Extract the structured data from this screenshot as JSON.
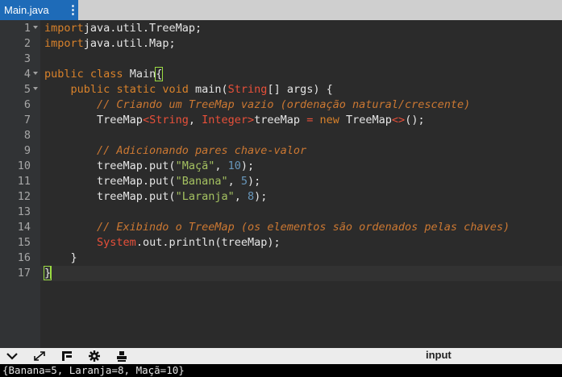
{
  "tab": {
    "title": "Main.java",
    "menu": "⋮"
  },
  "toolbar": {
    "input_label": "input",
    "icons": [
      "chevron-down-icon",
      "expand-icon",
      "layout-icon",
      "gear-icon",
      "stamp-icon"
    ]
  },
  "output": {
    "text": "{Banana=5, Laranja=8, Maçã=10}"
  },
  "editor": {
    "line_numbers": [
      "1",
      "2",
      "3",
      "4",
      "5",
      "6",
      "7",
      "8",
      "9",
      "10",
      "11",
      "12",
      "13",
      "14",
      "15",
      "16",
      "17"
    ],
    "current_line": "17",
    "lines": [
      [
        [
          "kw",
          "import"
        ],
        [
          "",
          "java.util.TreeMap;"
        ]
      ],
      [
        [
          "kw",
          "import"
        ],
        [
          "",
          "java.util.Map;"
        ]
      ],
      [],
      [
        [
          "kw",
          "public"
        ],
        [
          "",
          ""
        ],
        [
          "kw",
          "class"
        ],
        [
          "",
          ""
        ],
        [
          "cls",
          "Main"
        ],
        [
          "brace",
          "{"
        ]
      ],
      [
        [
          "",
          "    "
        ],
        [
          "kw",
          "public"
        ],
        [
          "",
          ""
        ],
        [
          "kw",
          "static"
        ],
        [
          "",
          ""
        ],
        [
          "kw",
          "void"
        ],
        [
          "",
          ""
        ],
        [
          "",
          "main("
        ],
        [
          "ty",
          "String"
        ],
        [
          "",
          "[] args) {"
        ]
      ],
      [
        [
          "",
          "        "
        ],
        [
          "cm",
          "// Criando um TreeMap vazio (ordenação natural/crescente)"
        ]
      ],
      [
        [
          "",
          "        "
        ],
        [
          "",
          "TreeMap"
        ],
        [
          "ty",
          "<String"
        ],
        [
          "",
          ","
        ],
        [
          "",
          ""
        ],
        [
          "ty",
          "Integer>"
        ],
        [
          "",
          "treeMap"
        ],
        [
          "",
          ""
        ],
        [
          "ty",
          "="
        ],
        [
          "",
          ""
        ],
        [
          "kw",
          "new"
        ],
        [
          "",
          ""
        ],
        [
          "",
          "TreeMap"
        ],
        [
          "ty",
          "<>"
        ],
        [
          "",
          "();"
        ]
      ],
      [],
      [
        [
          "",
          "        "
        ],
        [
          "cm",
          "// Adicionando pares chave-valor"
        ]
      ],
      [
        [
          "",
          "        "
        ],
        [
          "",
          "treeMap.put("
        ],
        [
          "str",
          "\"Maçã\""
        ],
        [
          "",
          ", "
        ],
        [
          "num",
          "10"
        ],
        [
          "",
          ");"
        ]
      ],
      [
        [
          "",
          "        "
        ],
        [
          "",
          "treeMap.put("
        ],
        [
          "str",
          "\"Banana\""
        ],
        [
          "",
          ", "
        ],
        [
          "num",
          "5"
        ],
        [
          "",
          ");"
        ]
      ],
      [
        [
          "",
          "        "
        ],
        [
          "",
          "treeMap.put("
        ],
        [
          "str",
          "\"Laranja\""
        ],
        [
          "",
          ", "
        ],
        [
          "num",
          "8"
        ],
        [
          "",
          ");"
        ]
      ],
      [],
      [
        [
          "",
          "        "
        ],
        [
          "cm",
          "// Exibindo o TreeMap (os elementos são ordenados pelas chaves)"
        ]
      ],
      [
        [
          "",
          "        "
        ],
        [
          "ty",
          "System"
        ],
        [
          "",
          ".out.println(treeMap);"
        ]
      ],
      [
        [
          "",
          "    "
        ],
        [
          "",
          "}"
        ]
      ],
      [
        [
          "brace",
          "}"
        ],
        [
          "caret",
          ""
        ]
      ]
    ],
    "foldable": [
      "1",
      "4",
      "5"
    ]
  }
}
